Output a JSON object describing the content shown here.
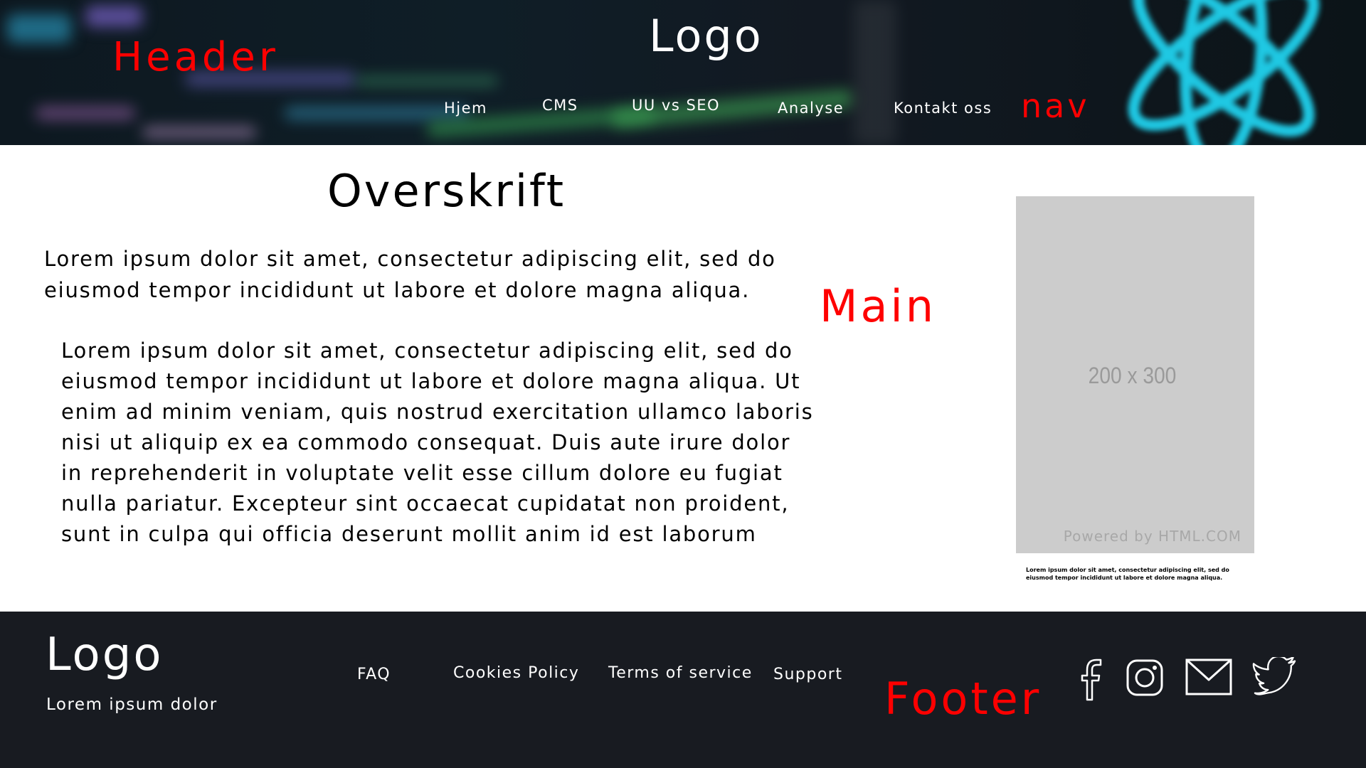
{
  "header": {
    "logo": "Logo",
    "label": "Header",
    "nav_label": "nav",
    "nav": [
      "Hjem",
      "CMS",
      "UU vs SEO",
      "Analyse",
      "Kontakt oss"
    ]
  },
  "main": {
    "label": "Main",
    "title": "Overskrift",
    "intro": "Lorem ipsum dolor sit amet, consectetur adipiscing elit, sed do eiusmod tempor incididunt ut labore et dolore magna aliqua.",
    "body": [
      "Lorem ipsum dolor sit amet, consectetur adipiscing elit, sed do",
      "eiusmod tempor incididunt ut labore et dolore magna aliqua. Ut",
      "enim ad minim veniam, quis nostrud exercitation ullamco laboris",
      "nisi ut aliquip ex ea commodo consequat. Duis aute irure dolor",
      "in reprehenderit in voluptate velit esse cillum dolore eu fugiat",
      "nulla pariatur. Excepteur sint occaecat cupidatat non proident,",
      "sunt in culpa qui officia deserunt mollit anim id est laborum"
    ],
    "image": {
      "dimensions": "200 x 300",
      "credit": "Powered by HTML.COM"
    },
    "caption": "Lorem ipsum dolor sit amet, consectetur adipiscing elit, sed do eiusmod tempor incididunt ut labore et dolore magna aliqua."
  },
  "footer": {
    "label": "Footer",
    "logo": "Logo",
    "tagline": "Lorem ipsum dolor",
    "links": [
      "FAQ",
      "Cookies Policy",
      "Terms of service",
      "Support"
    ],
    "social": [
      "facebook-icon",
      "instagram-icon",
      "mail-icon",
      "twitter-icon"
    ]
  },
  "colors": {
    "wireframe_label": "#ff0000",
    "footer_bg": "#181b21",
    "image_placeholder": "#cccccc",
    "react_cyan": "#1fc8e3"
  }
}
